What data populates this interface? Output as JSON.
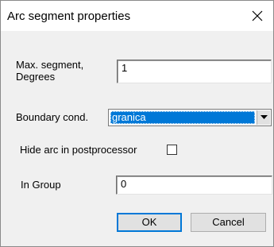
{
  "dialog": {
    "title": "Arc segment properties",
    "close_icon": "close-icon"
  },
  "fields": {
    "max_segment_label_line1": "Max. segment,",
    "max_segment_label_line2": "Degrees",
    "max_segment_value": "1",
    "boundary_cond_label": "Boundary cond.",
    "boundary_cond_value": "granica",
    "hide_arc_label": "Hide arc in postprocessor",
    "hide_arc_checked": false,
    "in_group_label": "In Group",
    "in_group_value": "0"
  },
  "buttons": {
    "ok_label": "OK",
    "cancel_label": "Cancel"
  },
  "colors": {
    "selection": "#0078d7",
    "dialog_bg": "#f0f0f0",
    "title_bg": "#ffffff"
  }
}
